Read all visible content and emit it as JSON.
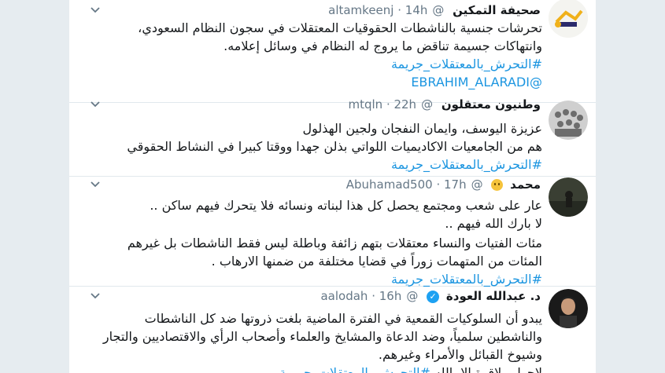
{
  "tweets": [
    {
      "name": "صحيفة التمكين",
      "handle": "@altamkeenj",
      "time": "· 14h",
      "lines": [
        "تحرشات جنسية بالناشطات الحقوقيات المعتقلات في سجون النظام السعودي،",
        "وانتهاكات جسيمة تناقض ما يروج له النظام في وسائل إعلامه."
      ],
      "hashtag": "#التحرش_بالمعتقلات_جريمة",
      "mention": "@EBRAHIM_ALARADI"
    },
    {
      "name": "وطنيون معتقلون",
      "handle": "@mtqln",
      "time": "· 22h",
      "lines": [
        "عزيزة اليوسف، وايمان النفجان ولجين الهذلول",
        "هم من الجامعيات الاكاديميات اللواتي بذلن جهدا ووقتا كبيرا في النشاط الحقوقي"
      ],
      "hashtag": "#التحرش_بالمعتقلات_جريمة"
    },
    {
      "name": "محمد",
      "handle": "@Abuhamad500",
      "time": "· 17h",
      "lines": [
        "عار على شعب ومجتمع يحصل كل هذا لبناته ونسائه فلا يتحرك فيهم ساكن ..",
        "لا بارك الله فيهم ..",
        "مئات الفتيات والنساء معتقلات بتهم زائفة وباطلة ليس فقط الناشطات بل غيرهم",
        "المئات من المتهمات زوراً في قضايا مختلفة من ضمنها الارهاب ."
      ],
      "hashtag": "#التحرش_بالمعتقلات_جريمة"
    },
    {
      "name": "د. عبدالله العودة",
      "handle": "@aalodah",
      "time": "· 16h",
      "lines": [
        "يبدو أن السلوكيات القمعية في الفترة الماضية بلغت ذروتها ضد كل الناشطات",
        "والناشطين سلمياً، وضد الدعاة والمشايخ والعلماء وأصحاب الرأي والاقتصاديين والتجار",
        "وشيوخ القبائل والأمراء وغيرهم."
      ],
      "last_line_text": "لاحول ولاقوة إلا بالله",
      "hashtag": "#التحرش_بالمعتقلات_جريمة"
    }
  ],
  "icons": {
    "menu": "chevron-down-icon",
    "verified": "verified-badge-icon",
    "emoji": "worried-face-emoji"
  },
  "colors": {
    "link": "#1b95e0",
    "text": "#14171a",
    "muted": "#657786",
    "verified": "#1da1f2"
  }
}
